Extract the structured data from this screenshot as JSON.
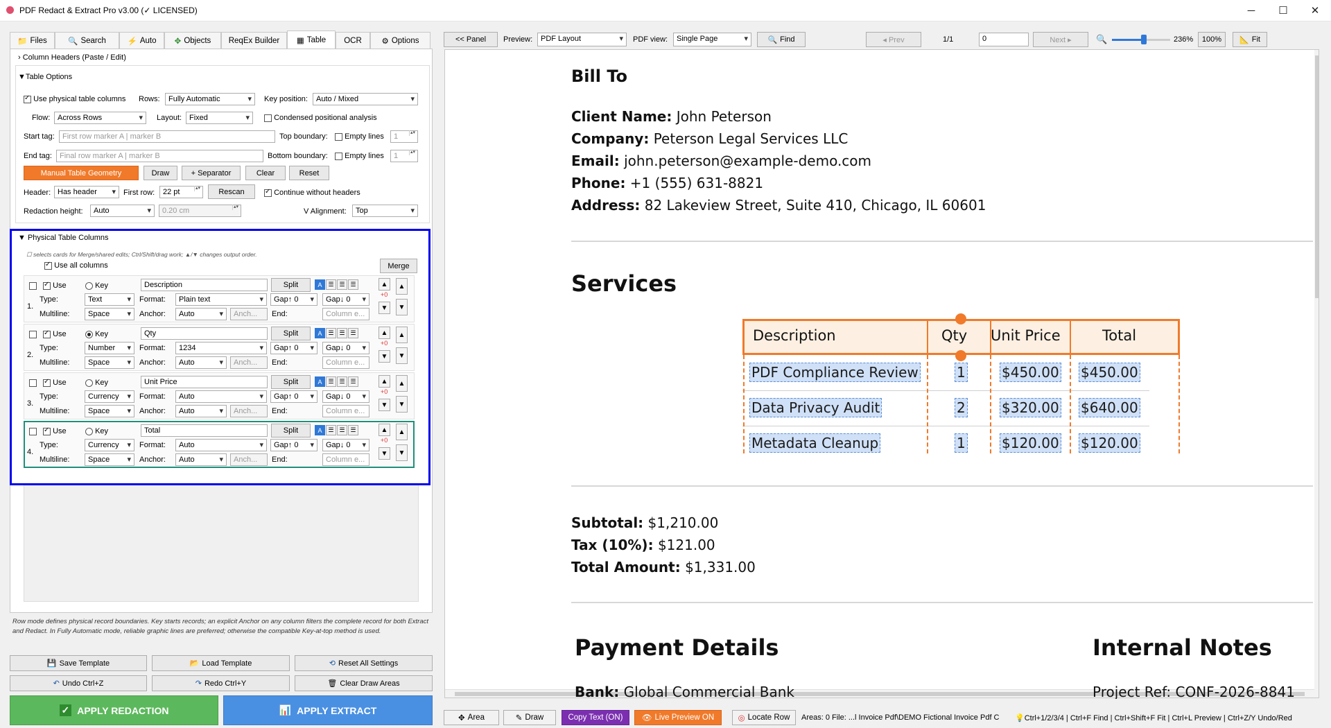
{
  "window": {
    "title": "PDF Redact & Extract Pro v3.00 (✓ LICENSED)",
    "minimize": "─",
    "maximize": "☐",
    "close": "✕"
  },
  "tabs": [
    {
      "label": "Files",
      "icon": "folder-icon"
    },
    {
      "label": "Search",
      "icon": "search-icon"
    },
    {
      "label": "Auto",
      "icon": "lightning-icon"
    },
    {
      "label": "Objects",
      "icon": "objects-icon"
    },
    {
      "label": "ReqEx Builder",
      "icon": ""
    },
    {
      "label": "Table",
      "icon": "table-icon"
    },
    {
      "label": "OCR",
      "icon": ""
    },
    {
      "label": "Options",
      "icon": "gear-icon"
    }
  ],
  "column_headers_section": "Column Headers (Paste / Edit)",
  "table_options": {
    "title": "Table Options",
    "use_physical_label": "Use physical table columns",
    "rows_label": "Rows:",
    "rows_value": "Fully Automatic",
    "key_position_label": "Key position:",
    "key_position_value": "Auto / Mixed",
    "flow_label": "Flow:",
    "flow_value": "Across Rows",
    "layout_label": "Layout:",
    "layout_value": "Fixed",
    "condensed_label": "Condensed positional analysis",
    "start_tag_label": "Start tag:",
    "start_tag_placeholder": "First row marker A | marker B",
    "top_boundary_label": "Top boundary:",
    "empty_lines_label": "Empty lines",
    "empty_lines_top": "1",
    "end_tag_label": "End tag:",
    "end_tag_placeholder": "Final row marker A | marker B",
    "bottom_boundary_label": "Bottom boundary:",
    "empty_lines_bottom": "1",
    "manual_geometry": "Manual Table Geometry",
    "draw": "Draw",
    "separator": "+ Separator",
    "clear": "Clear",
    "reset": "Reset",
    "header_label": "Header:",
    "header_value": "Has header",
    "first_row_label": "First row:",
    "first_row_value": "22 pt",
    "rescan": "Rescan",
    "continue_label": "Continue without headers",
    "redaction_height_label": "Redaction height:",
    "redaction_height_value": "Auto",
    "redaction_cm": "0.20 cm",
    "valign_label": "V Alignment:",
    "valign_value": "Top"
  },
  "physical_columns": {
    "title": "Physical Table Columns",
    "hint": "☐ selects cards for Merge/shared edits; Ctrl/Shift/drag work; ▲/▼ changes output order.",
    "use_all": "Use all columns",
    "merge": "Merge",
    "labels": {
      "use": "Use",
      "key": "Key",
      "split": "Split",
      "type": "Type:",
      "format": "Format:",
      "multiline": "Multiline:",
      "anchor": "Anchor:",
      "end": "End:",
      "anch_placeholder": "Anch...",
      "end_placeholder": "Column e...",
      "plus0": "+0"
    },
    "columns": [
      {
        "num": "1.",
        "name": "Description",
        "type": "Text",
        "format": "Plain text",
        "gap_up": "Gap↑ 0",
        "gap_down": "Gap↓ 0",
        "multiline": "Space",
        "anchor": "Auto",
        "key": false
      },
      {
        "num": "2.",
        "name": "Qty",
        "type": "Number",
        "format": "1234",
        "gap_up": "Gap↑ 0",
        "gap_down": "Gap↓ 0",
        "multiline": "Space",
        "anchor": "Auto",
        "key": true
      },
      {
        "num": "3.",
        "name": "Unit Price",
        "type": "Currency",
        "format": "Auto",
        "gap_up": "Gap↑ 0",
        "gap_down": "Gap↓ 0",
        "multiline": "Space",
        "anchor": "Auto",
        "key": false
      },
      {
        "num": "4.",
        "name": "Total",
        "type": "Currency",
        "format": "Auto",
        "gap_up": "Gap↑ 0",
        "gap_down": "Gap↓ 0",
        "multiline": "Space",
        "anchor": "Auto",
        "key": false
      }
    ]
  },
  "footer_note": "Row mode defines physical record boundaries. Key starts records; an explicit Anchor on any column filters the complete record for both Extract and Redact. In Fully Automatic mode, reliable graphic lines are preferred; otherwise the compatible Key-at-top method is used.",
  "bottom_buttons": {
    "save_template": "Save Template",
    "load_template": "Load Template",
    "reset_all": "Reset All Settings",
    "undo": "Undo  Ctrl+Z",
    "redo": "Redo  Ctrl+Y",
    "clear_draw": "Clear Draw Areas",
    "apply_redaction": "APPLY REDACTION",
    "apply_extract": "APPLY EXTRACT"
  },
  "viewer_toolbar": {
    "panel": "<< Panel",
    "preview_label": "Preview:",
    "preview_value": "PDF Layout",
    "pdf_view_label": "PDF view:",
    "pdf_view_value": "Single Page",
    "find": "Find",
    "prev": "◂ Prev",
    "page_count": "1/1",
    "page_input": "0",
    "next": "Next ▸",
    "zoom_pct": "236%",
    "zoom_100": "100%",
    "fit": "Fit",
    "zoom_level": 0.55
  },
  "document": {
    "bill_to": "Bill To",
    "client_label": "Client Name:",
    "client": "John Peterson",
    "company_label": "Company:",
    "company": "Peterson Legal Services LLC",
    "email_label": "Email:",
    "email": "john.peterson@example-demo.com",
    "phone_label": "Phone:",
    "phone": "+1 (555) 631-8821",
    "address_label": "Address:",
    "address": "82 Lakeview Street, Suite 410, Chicago, IL 60601",
    "services": "Services",
    "table_headers": [
      "Description",
      "Qty",
      "Unit Price",
      "Total"
    ],
    "table_rows": [
      [
        "PDF Compliance Review",
        "1",
        "$450.00",
        "$450.00"
      ],
      [
        "Data Privacy Audit",
        "2",
        "$320.00",
        "$640.00"
      ],
      [
        "Metadata Cleanup",
        "1",
        "$120.00",
        "$120.00"
      ]
    ],
    "subtotal_label": "Subtotal:",
    "subtotal": "$1,210.00",
    "tax_label": "Tax (10%):",
    "tax": "$121.00",
    "total_label": "Total Amount:",
    "total": "$1,331.00",
    "payment_details": "Payment Details",
    "internal_notes": "Internal Notes",
    "bank_label": "Bank:",
    "bank": "Global Commercial Bank",
    "project_label": "Project Ref:",
    "project": "CONF-2026-8841"
  },
  "statusbar": {
    "area": "Area",
    "draw": "Draw",
    "copy_text": "Copy Text (ON)",
    "live_preview": "Live Preview ON",
    "locate_row": "Locate Row",
    "info": "Areas: 0  File: ...l Invoice Pdf\\DEMO Fictional Invoice Pdf C",
    "shortcuts": "Ctrl+1/2/3/4 | Ctrl+F Find | Ctrl+Shift+F Fit | Ctrl+L Preview | Ctrl+Z/Y Undo/Red"
  },
  "colors": {
    "orange": "#f07a2a",
    "green": "#5cb85c",
    "blue": "#4a90e2",
    "purple": "#7b2fb0",
    "highlight_border": "#0000ee"
  }
}
